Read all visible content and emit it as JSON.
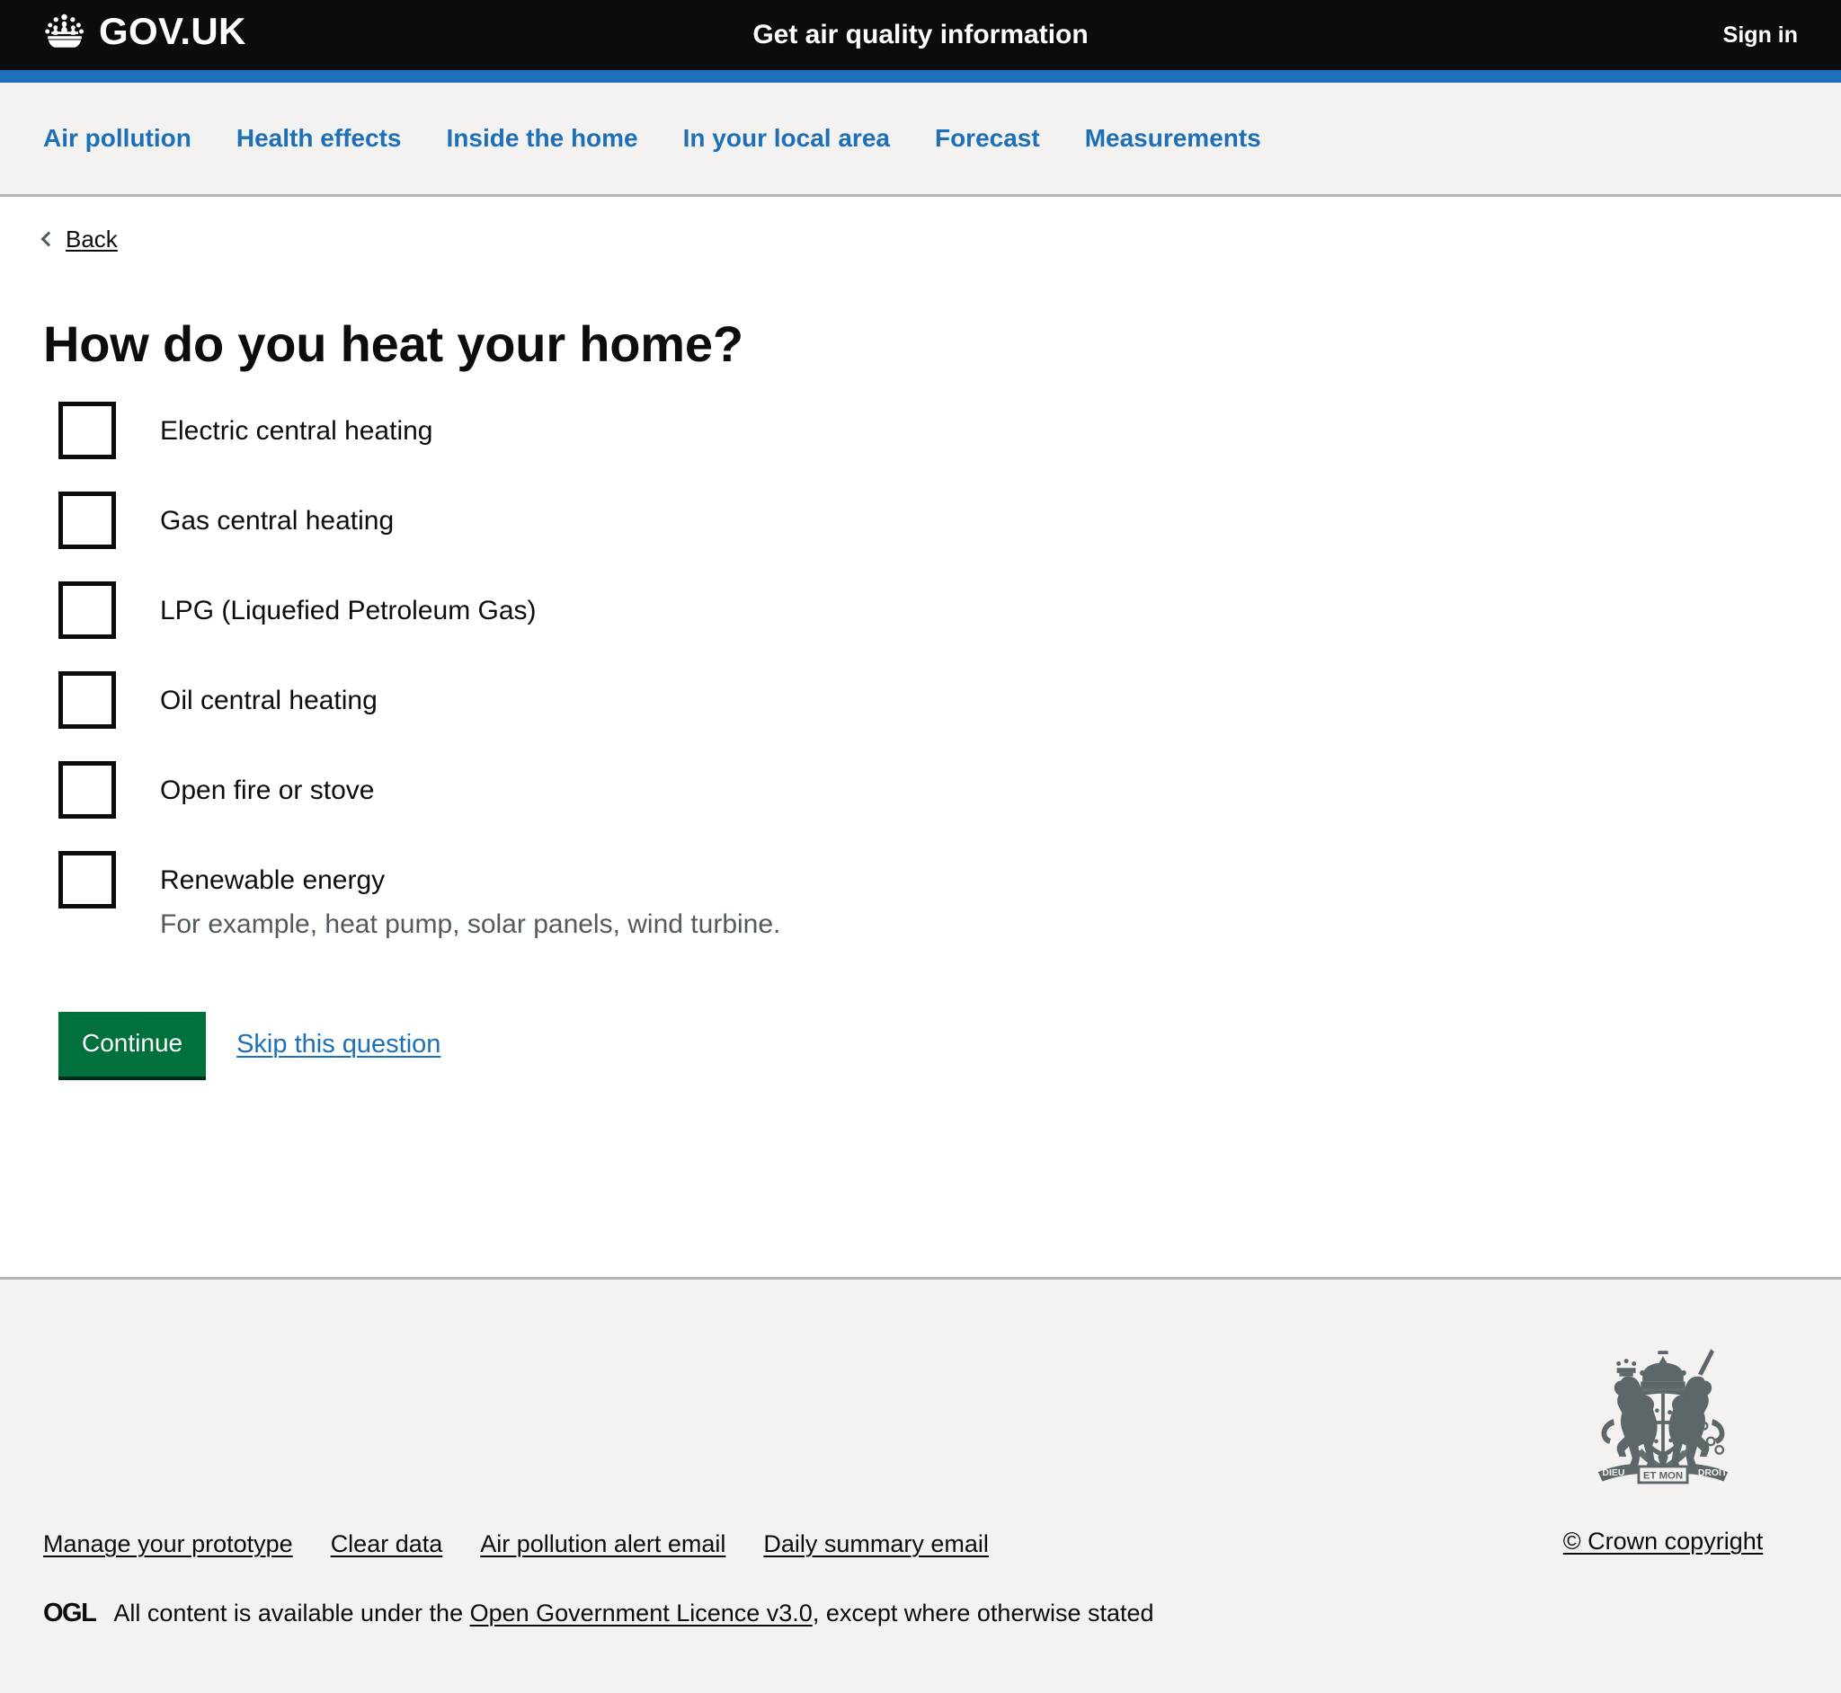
{
  "header": {
    "brand_text": "GOV.UK",
    "crown_icon": "crown-icon",
    "service_name": "Get air quality information",
    "sign_in_label": "Sign in",
    "background_color": "#0b0c0c",
    "accent_color": "#1d70b8"
  },
  "nav": {
    "items": [
      {
        "label": "Air pollution"
      },
      {
        "label": "Health effects"
      },
      {
        "label": "Inside the home"
      },
      {
        "label": "In your local area"
      },
      {
        "label": "Forecast"
      },
      {
        "label": "Measurements"
      }
    ],
    "link_color": "#1d70b8",
    "background_color": "#f3f2f1"
  },
  "main": {
    "back_label": "Back",
    "back_icon": "chevron-left-icon",
    "heading": "How do you heat your home?",
    "checkboxes": [
      {
        "label": "Electric central heating",
        "hint": ""
      },
      {
        "label": "Gas central heating",
        "hint": ""
      },
      {
        "label": "LPG (Liquefied Petroleum Gas)",
        "hint": ""
      },
      {
        "label": "Oil central heating",
        "hint": ""
      },
      {
        "label": "Open fire or stove",
        "hint": ""
      },
      {
        "label": "Renewable energy",
        "hint": "For example, heat pump, solar panels, wind turbine."
      }
    ],
    "continue_label": "Continue",
    "skip_label": "Skip this question",
    "button_color": "#00703c",
    "link_color": "#1d70b8"
  },
  "footer": {
    "links": [
      {
        "label": "Manage your prototype"
      },
      {
        "label": "Clear data"
      },
      {
        "label": "Air pollution alert email"
      },
      {
        "label": "Daily summary email"
      }
    ],
    "ogl_logo_text": "OGL",
    "licence_prefix": "All content is available under the ",
    "licence_link": "Open Government Licence v3.0",
    "licence_suffix": ", except where otherwise stated",
    "crown_copyright_label": "© Crown copyright",
    "crest_icon": "royal-coat-of-arms-icon",
    "background_color": "#f3f2f1"
  }
}
